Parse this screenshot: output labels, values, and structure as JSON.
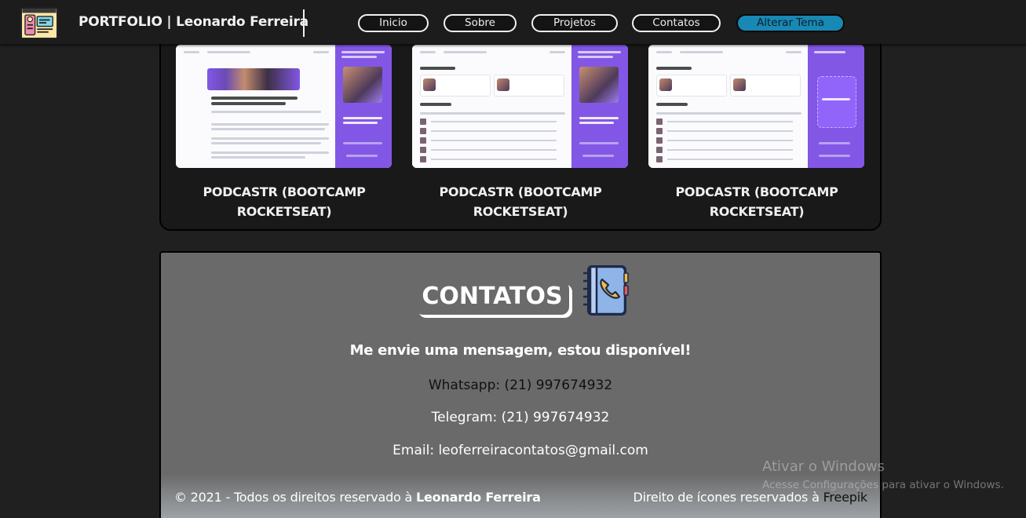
{
  "header": {
    "brand": "PORTFOLIO | Leonardo Ferreira",
    "nav": [
      {
        "label": "Inicio"
      },
      {
        "label": "Sobre"
      },
      {
        "label": "Projetos"
      },
      {
        "label": "Contatos"
      }
    ],
    "theme_button": "Alterar Tema",
    "logo_icon": "portfolio-document-icon"
  },
  "projects": [
    {
      "title": "PODCASTR (BOOTCAMP ROCKETSEAT)"
    },
    {
      "title": "PODCASTR (BOOTCAMP ROCKETSEAT)"
    },
    {
      "title": "PODCASTR (BOOTCAMP ROCKETSEAT)"
    }
  ],
  "contact": {
    "heading": "CONTATOS",
    "icon": "phone-book-icon",
    "message": "Me envie uma mensagem, estou disponível!",
    "whatsapp": "Whatsapp: (21) 997674932",
    "telegram": "Telegram: (21) 997674932",
    "email": "Email: leoferreiracontatos@gmail.com"
  },
  "footer": {
    "copyright_prefix": "© 2021 - Todos os direitos reservado à ",
    "copyright_name": "Leonardo Ferreira",
    "icons_prefix": "Direito de ícones reservados à ",
    "icons_link": "Freepik"
  },
  "watermark": {
    "line1": "Ativar o Windows",
    "line2": "Acesse Configurações para ativar o Windows."
  },
  "colors": {
    "background": "#202020",
    "panel": "#191919",
    "contact_panel": "#6a6a6a",
    "theme_button": "#1888b4",
    "thumb_accent": "#8257e5"
  }
}
